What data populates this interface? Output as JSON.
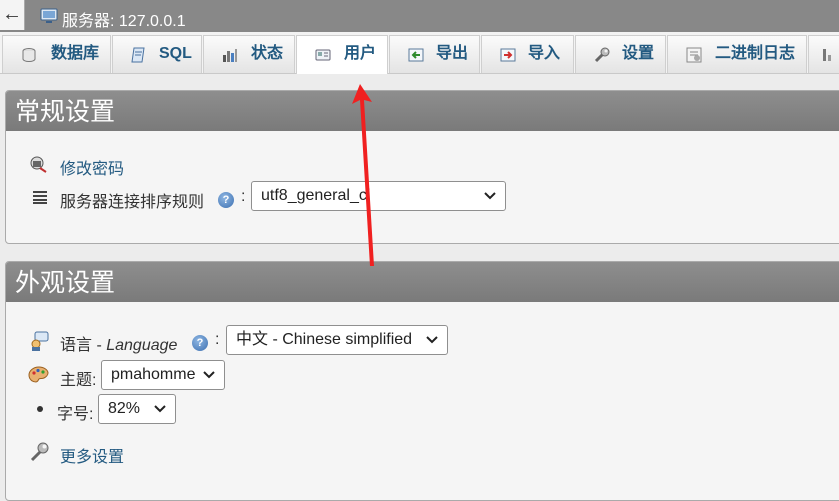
{
  "topbar": {
    "back_glyph": "←",
    "server_title": "服务器: 127.0.0.1"
  },
  "tabs": [
    {
      "label": "数据库",
      "icon": "database-icon"
    },
    {
      "label": "SQL",
      "icon": "sql-icon"
    },
    {
      "label": "状态",
      "icon": "status-icon"
    },
    {
      "label": "用户",
      "icon": "users-icon"
    },
    {
      "label": "导出",
      "icon": "export-icon"
    },
    {
      "label": "导入",
      "icon": "import-icon"
    },
    {
      "label": "设置",
      "icon": "settings-icon"
    },
    {
      "label": "二进制日志",
      "icon": "binlog-icon"
    }
  ],
  "general": {
    "heading": "常规设置",
    "change_password": "修改密码",
    "collation_label": "服务器连接排序规则",
    "colon": ":",
    "collation_value": "utf8_general_ci"
  },
  "appearance": {
    "heading": "外观设置",
    "language_label": "语言 - ",
    "language_label_en": "Language",
    "colon": ":",
    "language_value": "中文 - Chinese simplified",
    "theme_label": "主题:",
    "theme_value": "pmahomme",
    "font_label": "字号:",
    "font_value": "82%",
    "more_settings": "更多设置"
  },
  "help_glyph": "?",
  "colors": {
    "link": "#235a81",
    "header_bg": "#888888",
    "arrow": "#f02020"
  }
}
